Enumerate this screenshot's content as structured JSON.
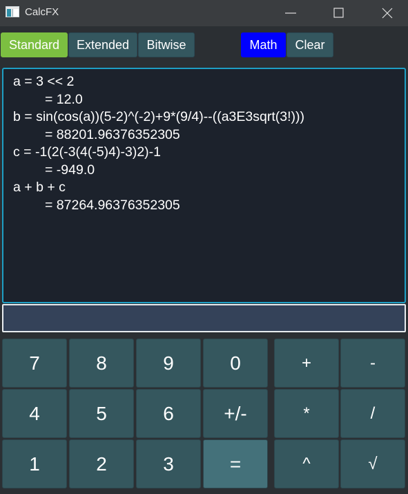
{
  "window": {
    "title": "CalcFX",
    "icon": "app-icon",
    "controls": [
      "minimize-icon",
      "maximize-icon",
      "close-icon"
    ]
  },
  "toolbar": {
    "tabs": [
      {
        "label": "Standard",
        "active": true
      },
      {
        "label": "Extended",
        "active": false
      },
      {
        "label": "Bitwise",
        "active": false
      }
    ],
    "math_label": "Math",
    "clear_label": "Clear"
  },
  "output": {
    "lines": [
      {
        "text": "a = 3 << 2",
        "type": "expression"
      },
      {
        "text": "= 12.0",
        "type": "result"
      },
      {
        "text": "b = sin(cos(a))(5-2)^(-2)+9*(9/4)--((a3E3sqrt(3!)))",
        "type": "expression"
      },
      {
        "text": "= 88201.96376352305",
        "type": "result"
      },
      {
        "text": "c = -1(2(-3(4(-5)4)-3)2)-1",
        "type": "expression"
      },
      {
        "text": "= -949.0",
        "type": "result"
      },
      {
        "text": "a + b + c",
        "type": "expression"
      },
      {
        "text": "= 87264.96376352305",
        "type": "result"
      }
    ]
  },
  "input": {
    "value": "",
    "placeholder": ""
  },
  "keypad": {
    "numbers": [
      "7",
      "8",
      "9",
      "0",
      "4",
      "5",
      "6",
      "+/-",
      "1",
      "2",
      "3",
      "="
    ],
    "operators": [
      "+",
      "-",
      "*",
      "/",
      "^",
      "√"
    ]
  },
  "colors": {
    "active_tab": "#7cbf41",
    "math_button": "#0000ff",
    "output_border": "#1e9fc4",
    "output_bg": "#1c222c",
    "key_bg": "#35575e",
    "equals_bg": "#44717a"
  }
}
